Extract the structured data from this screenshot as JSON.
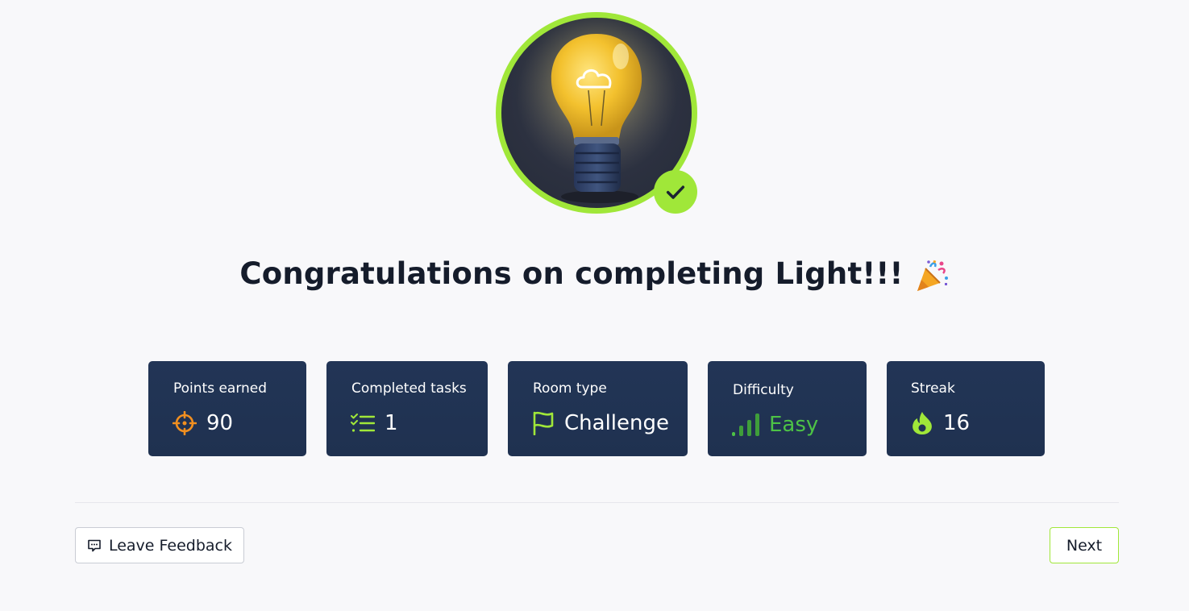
{
  "room": {
    "name": "Light",
    "badge_icon": "lightbulb-icon",
    "completed_icon": "check-icon"
  },
  "heading": {
    "text": "Congratulations on completing Light!!!",
    "emoji": "party-popper-icon"
  },
  "stats": [
    {
      "label": "Points earned",
      "value": "90",
      "icon": "target-icon"
    },
    {
      "label": "Completed tasks",
      "value": "1",
      "icon": "task-list-icon"
    },
    {
      "label": "Room type",
      "value": "Challenge",
      "icon": "flag-icon"
    },
    {
      "label": "Difficulty",
      "value": "Easy",
      "icon": "signal-bars-icon"
    },
    {
      "label": "Streak",
      "value": "16",
      "icon": "flame-icon"
    }
  ],
  "footer": {
    "feedback_label": "Leave Feedback",
    "feedback_icon": "feedback-icon",
    "next_label": "Next"
  },
  "colors": {
    "accent": "#a0e739",
    "card_bg": "#213454",
    "target_orange": "#f18f20",
    "easy_green": "#4dc246",
    "page_bg": "#f8f8fa",
    "title_text": "#151c2b"
  }
}
